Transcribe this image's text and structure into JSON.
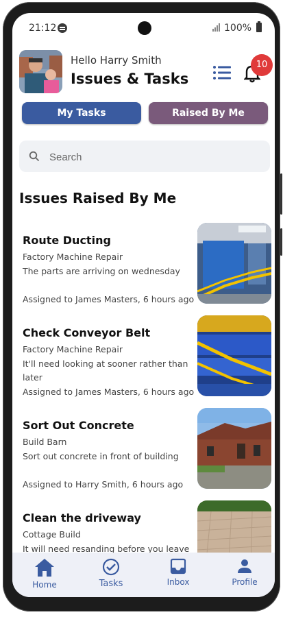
{
  "status_bar": {
    "time": "21:12",
    "battery": "100%"
  },
  "header": {
    "greeting": "Hello Harry Smith",
    "title": "Issues & Tasks",
    "notification_count": "10"
  },
  "tabs": {
    "my_tasks": "My Tasks",
    "raised_by_me": "Raised By Me"
  },
  "search": {
    "placeholder": "Search"
  },
  "section_title": "Issues Raised By Me",
  "issues": [
    {
      "title": "Route Ducting",
      "project": "Factory Machine Repair",
      "description": "The parts are arriving on wednesday",
      "assigned": "Assigned to James Masters, 6 hours ago"
    },
    {
      "title": "Check Conveyor Belt",
      "project": "Factory Machine Repair",
      "description": "It'll need looking at sooner rather than later",
      "assigned": "Assigned to James Masters, 6 hours ago"
    },
    {
      "title": "Sort Out Concrete",
      "project": "Build Barn",
      "description": "Sort out concrete in front of building",
      "assigned": "Assigned to Harry Smith, 6 hours ago"
    },
    {
      "title": "Clean the driveway",
      "project": "Cottage Build",
      "description": "It will need resanding before you leave",
      "assigned": ""
    }
  ],
  "bottom_nav": [
    {
      "label": "Home",
      "icon": "home-icon"
    },
    {
      "label": "Tasks",
      "icon": "check-circle-icon"
    },
    {
      "label": "Inbox",
      "icon": "inbox-icon"
    },
    {
      "label": "Profile",
      "icon": "person-icon"
    }
  ],
  "colors": {
    "primary": "#3a5ba0",
    "secondary": "#7a5a7b",
    "badge": "#e03a3a"
  }
}
